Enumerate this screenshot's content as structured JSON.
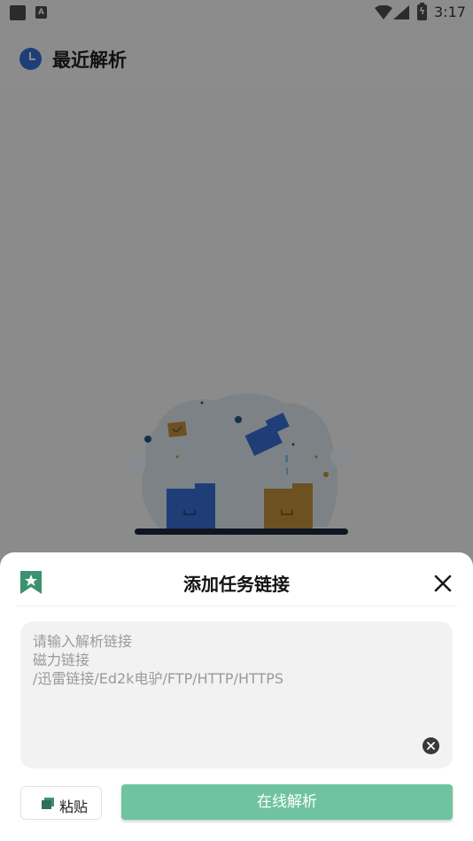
{
  "status_bar": {
    "notification_icon": "A",
    "time": "3:17"
  },
  "app_bar": {
    "title": "最近解析",
    "icon": "clock-icon"
  },
  "sheet": {
    "title": "添加任务链接",
    "input": {
      "value": "",
      "placeholder": "请输入解析链接\n磁力链接\n/迅雷链接/Ed2k电驴/FTP/HTTP/HTTPS"
    },
    "paste_label": "粘贴",
    "parse_label": "在线解析"
  },
  "colors": {
    "accent": "#70c3a1",
    "icon_green": "#3a9270",
    "overlay_bg": "#8b8b8b"
  }
}
